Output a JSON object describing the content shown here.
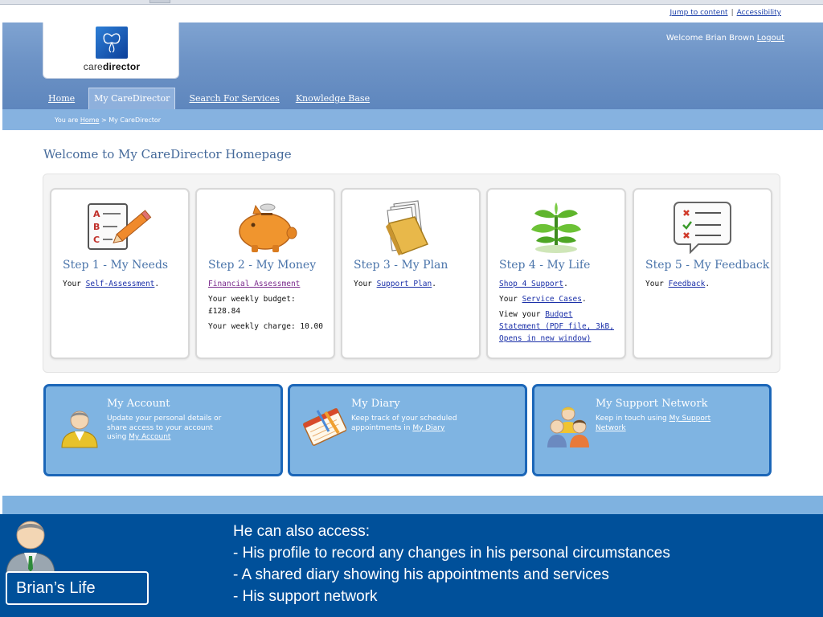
{
  "top_links": {
    "skip": "Jump to content",
    "accessibility": "Accessibility"
  },
  "logo": {
    "prefix": "care",
    "suffix": "director"
  },
  "welcome": {
    "text": "Welcome  Brian Brown",
    "logout": "Logout"
  },
  "nav": [
    {
      "label": "Home"
    },
    {
      "label": "My CareDirector",
      "active": true
    },
    {
      "label": "Search For Services"
    },
    {
      "label": "Knowledge Base"
    }
  ],
  "breadcrumb": {
    "prefix": "You are",
    "home": "Home",
    "current": "> My CareDirector"
  },
  "page_title": "Welcome to My CareDirector Homepage",
  "steps": [
    {
      "title": "Step 1 - My Needs",
      "icon": "checklist-pencil-icon",
      "line1_pre": "Your ",
      "line1_link": "Self-Assessment",
      "line1_post": "."
    },
    {
      "title": "Step 2 - My Money",
      "icon": "piggy-bank-icon",
      "link": "Financial Assessment",
      "budget": "Your weekly budget:£128.84",
      "charge": "Your weekly charge: 10.00"
    },
    {
      "title": "Step 3 - My Plan",
      "icon": "folder-icon",
      "line1_pre": "Your ",
      "line1_link": "Support Plan",
      "line1_post": "."
    },
    {
      "title": "Step 4 - My Life",
      "icon": "plant-icon",
      "shop_link": "Shop 4 Support",
      "cases_pre": "Your ",
      "cases_link": "Service Cases",
      "statement_pre": "View your ",
      "statement_link": "Budget Statement (PDF file, 3kB, Opens in new window)"
    },
    {
      "title": "Step 5 - My Feedback",
      "icon": "feedback-bubble-icon",
      "line1_pre": "Your ",
      "line1_link": "Feedback",
      "line1_post": "."
    }
  ],
  "tiles": [
    {
      "title": "My Account",
      "icon": "person-icon",
      "body": "Update your personal details or share access to your account using ",
      "link": "My Account"
    },
    {
      "title": "My Diary",
      "icon": "diary-icon",
      "body": "Keep track of your scheduled appointments in ",
      "link": "My Diary"
    },
    {
      "title": "My Support Network",
      "icon": "group-icon",
      "body": "Keep in touch using ",
      "link": "My Support Network"
    }
  ],
  "caption": {
    "label": "Brian’s Life",
    "lines": [
      "He can also access:",
      "- His profile to record any changes in his personal circumstances",
      "- A shared diary showing his appointments and services",
      "- His support network"
    ]
  },
  "colors": {
    "header": "#6d93c6",
    "tile": "#7fb4e2",
    "tile_border": "#1b66b8",
    "caption_bg": "#00509a",
    "title": "#4a74aa"
  }
}
